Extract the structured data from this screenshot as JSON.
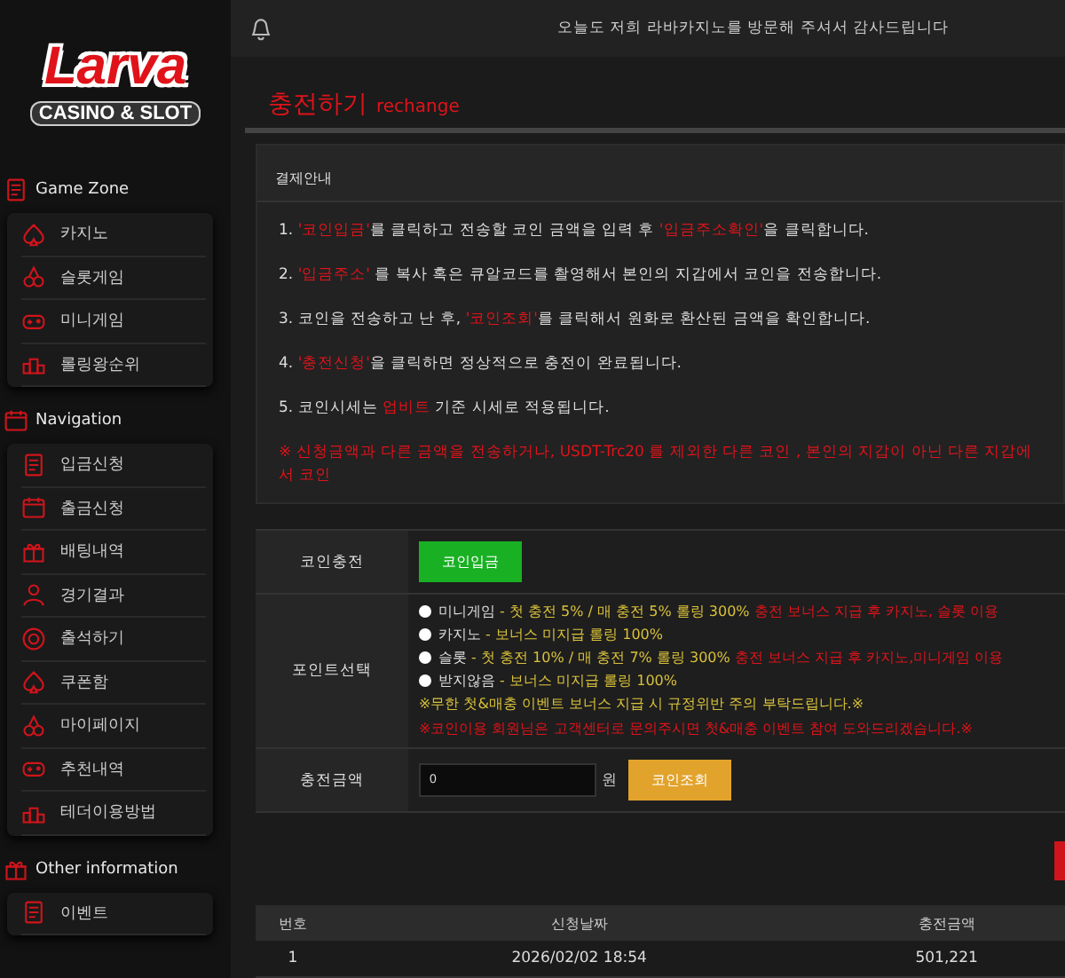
{
  "logo": {
    "title": "Larva",
    "subtitle": "CASINO & SLOT"
  },
  "header": {
    "message": "오늘도 저희 라바카지노를 방문해 주셔서 감사드립니다"
  },
  "sidebar": [
    {
      "title": "Game Zone",
      "items": [
        {
          "label": "카지노"
        },
        {
          "label": "슬롯게임"
        },
        {
          "label": "미니게임"
        },
        {
          "label": "롤링왕순위"
        }
      ]
    },
    {
      "title": "Navigation",
      "items": [
        {
          "label": "입금신청"
        },
        {
          "label": "출금신청"
        },
        {
          "label": "배팅내역"
        },
        {
          "label": "경기결과"
        },
        {
          "label": "출석하기"
        },
        {
          "label": "쿠폰함"
        },
        {
          "label": "마이페이지"
        },
        {
          "label": "추천내역"
        },
        {
          "label": "테더이용방법"
        }
      ]
    },
    {
      "title": "Other information",
      "items": [
        {
          "label": "이벤트"
        }
      ]
    }
  ],
  "page_title": {
    "main": "충전하기",
    "sub": "rechange"
  },
  "guide": {
    "title": "결제안내",
    "steps": [
      [
        {
          "text": "1. ",
          "red": false
        },
        {
          "text": "'코인입금'",
          "red": true
        },
        {
          "text": "를 클릭하고 전송할 코인 금액을 입력 후 ",
          "red": false
        },
        {
          "text": "'입금주소확인'",
          "red": true
        },
        {
          "text": "을 클릭합니다.",
          "red": false
        }
      ],
      [
        {
          "text": "2. ",
          "red": false
        },
        {
          "text": "'입금주소'",
          "red": true
        },
        {
          "text": " 를 복사 혹은 큐알코드를 촬영해서 본인의 지갑에서 코인을 전송합니다.",
          "red": false
        }
      ],
      [
        {
          "text": "3. 코인을 전송하고 난 후, ",
          "red": false
        },
        {
          "text": "'코인조회'",
          "red": true
        },
        {
          "text": "를 클릭해서 원화로 환산된 금액을 확인합니다.",
          "red": false
        }
      ],
      [
        {
          "text": "4. ",
          "red": false
        },
        {
          "text": "'충전신청'",
          "red": true
        },
        {
          "text": "을 클릭하면 정상적으로 충전이 완료됩니다.",
          "red": false
        }
      ],
      [
        {
          "text": "5. 코인시세는 ",
          "red": false
        },
        {
          "text": "업비트",
          "red": true
        },
        {
          "text": " 기준 시세로 적용됩니다.",
          "red": false
        }
      ]
    ],
    "warning": "※ 신청금액과 다른 금액을 전송하거나, USDT-Trc20 를 제외한 다른 코인 , 본인의 지갑이 아닌 다른 지갑에서 코인"
  },
  "form": {
    "coin_label": "코인충전",
    "coin_button": "코인입금",
    "point_label": "포인트선택",
    "options": [
      {
        "name": "미니게임",
        "desc": " - 첫 충전 5% / 매 충전 5% 롤링 300%",
        "note": " 충전 보너스 지급 후 카지노, 슬롯 이용",
        "selected": false
      },
      {
        "name": "카지노",
        "desc": " - 보너스 미지급 롤링 100%",
        "selected": false
      },
      {
        "name": "슬롯",
        "desc": " - 첫 충전 10% / 매 충전 7% 롤링 300%",
        "note": " 충전 보너스 지급 후 카지노,미니게임 이용",
        "selected": false
      },
      {
        "name": "받지않음",
        "desc": " - 보너스 미지급 롤링 100%",
        "selected": false
      }
    ],
    "notice_yellow": "※무한 첫&매충 이벤트 보너스 지급 시 규정위반 주의 부탁드립니다.※",
    "notice_red": "※코인이용 회원님은 고객센터로 문의주시면 첫&매충 이벤트 참여 도와드리겠습니다.※",
    "amount_label": "충전금액",
    "amount_value": "0",
    "unit": "원",
    "check_button": "코인조회"
  },
  "history": {
    "columns": [
      "번호",
      "신청날짜",
      "충전금액"
    ],
    "rows": [
      [
        "1",
        "2026/02/02 18:54",
        "501,221"
      ]
    ]
  }
}
